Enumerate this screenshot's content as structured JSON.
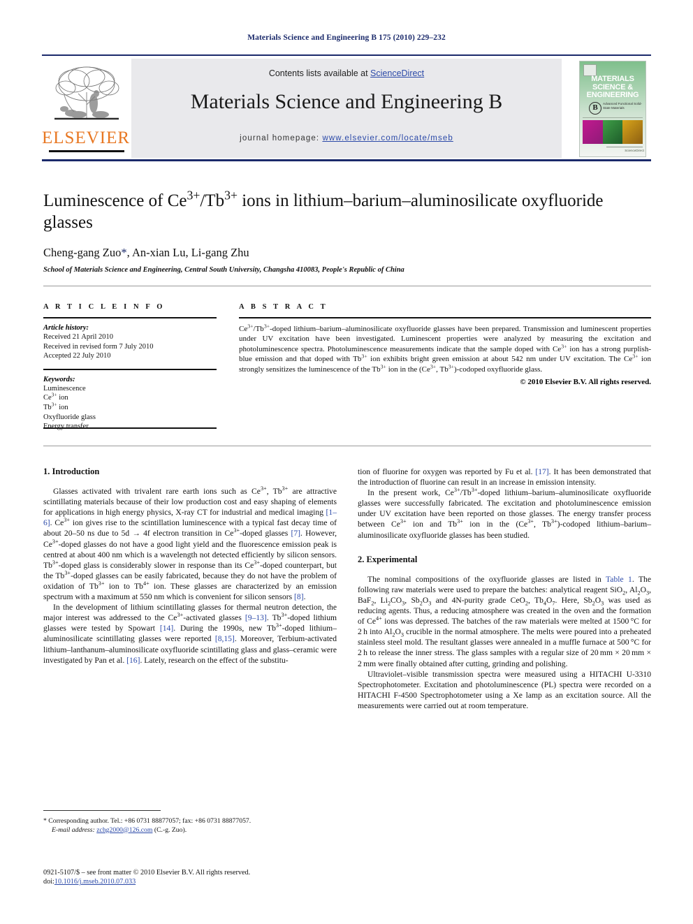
{
  "running_head": "Materials Science and Engineering B 175 (2010) 229–232",
  "masthead": {
    "contents_prefix": "Contents lists available at ",
    "sciencedirect": "ScienceDirect",
    "journal_title": "Materials Science and Engineering B",
    "homepage_prefix": "journal homepage: ",
    "homepage_url": "www.elsevier.com/locate/mseb",
    "publisher_name": "ELSEVIER",
    "cover": {
      "title_lines": [
        "MATERIALS",
        "SCIENCE &",
        "ENGINEERING"
      ],
      "badge": "B",
      "subtitle": "Advanced Functional Solid-State Materials",
      "footer": "ScienceDirect"
    }
  },
  "article": {
    "title": "Luminescence of Ce3+/Tb3+ ions in lithium–barium–aluminosilicate oxyfluoride glasses",
    "authors": "Cheng-gang Zuo, An-xian Lu, Li-gang Zhu",
    "affiliation": "School of Materials Science and Engineering, Central South University, Changsha 410083, People's Republic of China"
  },
  "article_info": {
    "heading": "A R T I C L E    I N F O",
    "history_title": "Article history:",
    "history": [
      "Received 21 April 2010",
      "Received in revised form 7 July 2010",
      "Accepted 22 July 2010"
    ],
    "keywords_title": "Keywords:",
    "keywords": [
      "Luminescence",
      "Ce3+ ion",
      "Tb3+ ion",
      "Oxyfluoride glass",
      "Energy transfer"
    ]
  },
  "abstract": {
    "heading": "A B S T R A C T",
    "text": "Ce3+/Tb3+-doped lithium–barium–aluminosilicate oxyfluoride glasses have been prepared. Transmission and luminescent properties under UV excitation have been investigated. Luminescent properties were analyzed by measuring the excitation and photoluminescence spectra. Photoluminescence measurements indicate that the sample doped with Ce3+ ion has a strong purplish-blue emission and that doped with Tb3+ ion exhibits bright green emission at about 542 nm under UV excitation. The Ce3+ ion strongly sensitizes the luminescence of the Tb3+ ion in the (Ce3+, Tb3+)-codoped oxyfluoride glass.",
    "copyright": "© 2010 Elsevier B.V. All rights reserved."
  },
  "sections": {
    "introduction_heading": "1.  Introduction",
    "experimental_heading": "2.  Experimental",
    "intro_p1": "Glasses activated with trivalent rare earth ions such as Ce3+, Tb3+ are attractive scintillating materials because of their low production cost and easy shaping of elements for applications in high energy physics, X-ray CT for industrial and medical imaging [1–6]. Ce3+ ion gives rise to the scintillation luminescence with a typical fast decay time of about 20–50 ns due to 5d → 4f electron transition in Ce3+-doped glasses [7]. However, Ce3+-doped glasses do not have a good light yield and the fluorescence emission peak is centred at about 400 nm which is a wavelength not detected efficiently by silicon sensors. Tb3+-doped glass is considerably slower in response than its Ce3+-doped counterpart, but the Tb3+-doped glasses can be easily fabricated, because they do not have the problem of oxidation of Tb3+ ion to Tb4+ ion. These glasses are characterized by an emission spectrum with a maximum at 550 nm which is convenient for silicon sensors [8].",
    "intro_p2": "In the development of lithium scintillating glasses for thermal neutron detection, the major interest was addressed to the Ce3+-activated glasses [9–13]. Tb3+-doped lithium glasses were tested by Spowart [14]. During the 1990s, new Tb3+-doped lithium–aluminosilicate scintillating glasses were reported [8,15]. Moreover, Terbium-activated lithium–lanthanum–aluminosilicate oxyfluoride scintillating glass and glass–ceramic were investigated by Pan et al. [16]. Lately, research on the effect of the substitu-",
    "intro_p2_cont": "tion of fluorine for oxygen was reported by Fu et al. [17]. It has been demonstrated that the introduction of fluorine can result in an increase in emission intensity.",
    "intro_p3": "In the present work, Ce3+/Tb3+-doped lithium–barium–aluminosilicate oxyfluoride glasses were successfully fabricated. The excitation and photoluminescence emission under UV excitation have been reported on those glasses. The energy transfer process between Ce3+ ion and Tb3+ ion in the (Ce3+, Tb3+)-codoped lithium–barium–aluminosilicate oxyfluoride glasses has been studied.",
    "exp_p1": "The nominal compositions of the oxyfluoride glasses are listed in Table 1. The following raw materials were used to prepare the batches: analytical reagent SiO2, Al2O3, BaF2, Li2CO3, Sb2O3 and 4N-purity grade CeO2, Tb4O7. Here, Sb2O3 was used as reducing agents. Thus, a reducing atmosphere was created in the oven and the formation of Ce4+ ions was depressed. The batches of the raw materials were melted at 1500 °C for 2 h into Al2O3 crucible in the normal atmosphere. The melts were poured into a preheated stainless steel mold. The resultant glasses were annealed in a muffle furnace at 500 °C for 2 h to release the inner stress. The glass samples with a regular size of 20 mm × 20 mm × 2 mm were finally obtained after cutting, grinding and polishing.",
    "exp_p2": "Ultraviolet–visible transmission spectra were measured using a HITACHI U-3310 Spectrophotometer. Excitation and photoluminescence (PL) spectra were recorded on a HITACHI F-4500 Spectrophotometer using a Xe lamp as an excitation source. All the measurements were carried out at room temperature."
  },
  "footnotes": {
    "corresponding": "* Corresponding author. Tel.: +86 0731 88877057; fax: +86 0731 88877057.",
    "email_label": "E-mail address:",
    "email": "zchg2000@126.com",
    "email_suffix": " (C.-g. Zuo).",
    "issn_line": "0921-5107/$ – see front matter © 2010 Elsevier B.V. All rights reserved.",
    "doi_label": "doi:",
    "doi": "10.1016/j.mseb.2010.07.033"
  },
  "colors": {
    "rule_blue": "#1b2a6b",
    "link_blue": "#2b49a8",
    "elsevier_orange": "#e87722",
    "panel_grey": "#e9e9ec"
  }
}
